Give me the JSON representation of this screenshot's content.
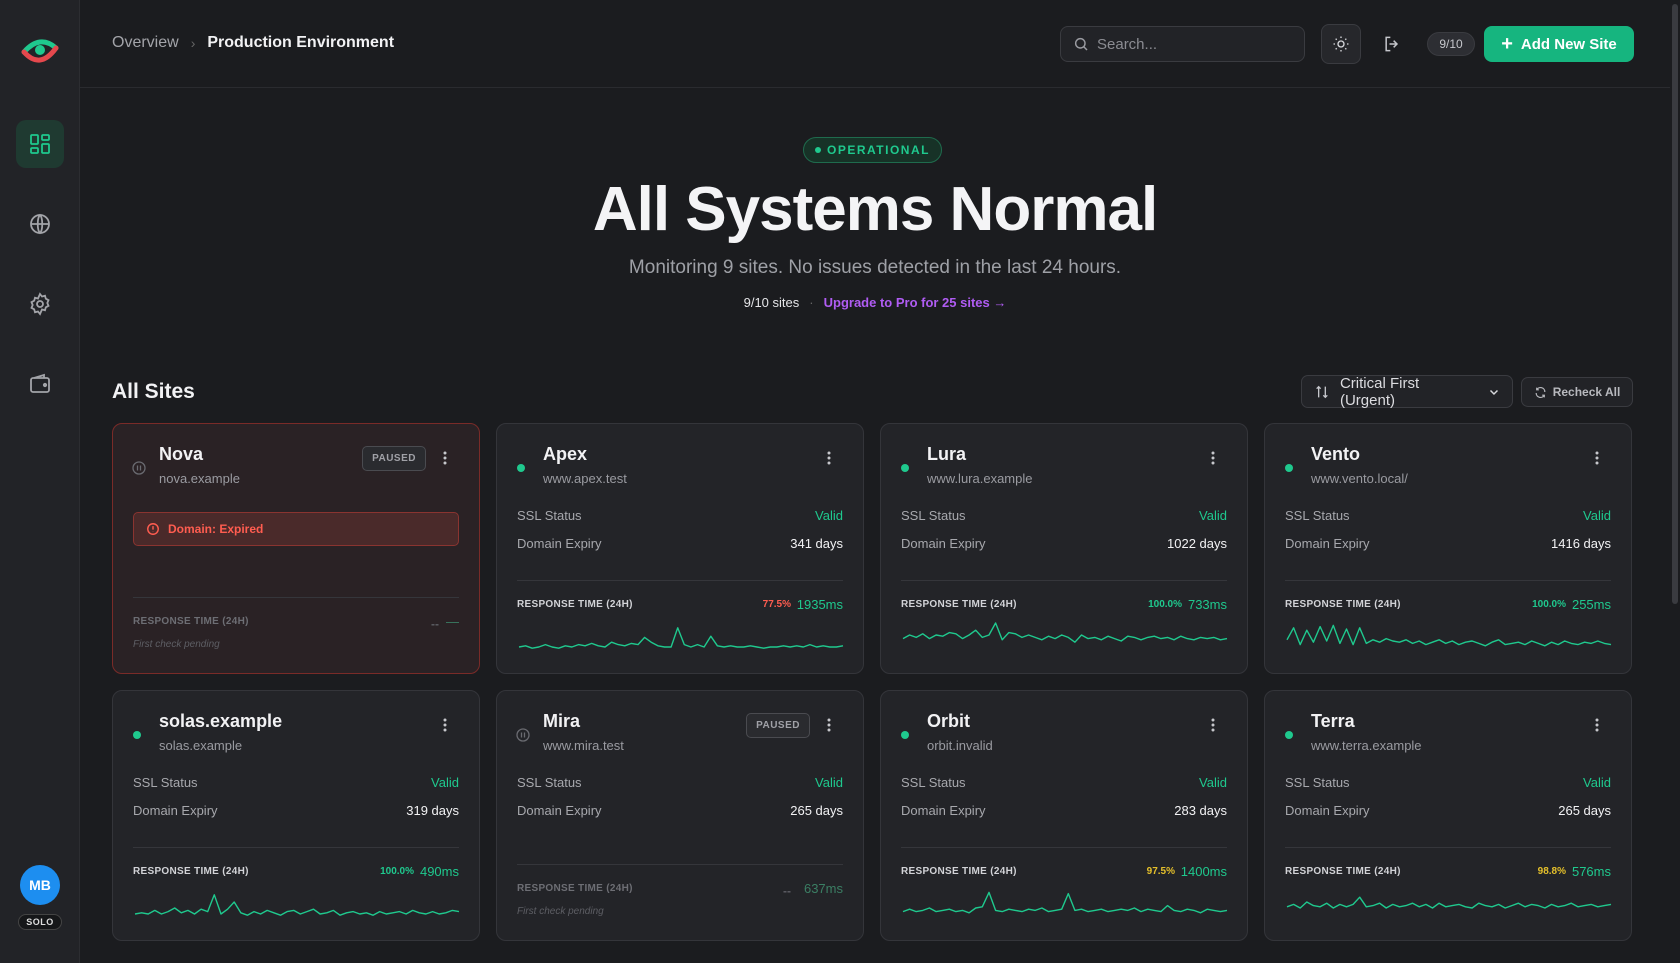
{
  "nav": {
    "items": [
      {
        "name": "dashboard",
        "icon": "dashboard-grid-icon",
        "active": true
      },
      {
        "name": "sites",
        "icon": "globe-icon",
        "active": false
      },
      {
        "name": "settings",
        "icon": "gear-icon",
        "active": false
      },
      {
        "name": "billing",
        "icon": "wallet-icon",
        "active": false
      }
    ],
    "avatar_initials": "MB",
    "plan": "SOLO"
  },
  "header": {
    "breadcrumb_root": "Overview",
    "breadcrumb_current": "Production Environment",
    "search_placeholder": "Search...",
    "quota": "9/10",
    "add_site_label": "Add New Site"
  },
  "hero": {
    "status": "OPERATIONAL",
    "title": "All Systems Normal",
    "subtitle": "Monitoring 9 sites. No issues detected in the last 24 hours.",
    "site_count": "9/10 sites",
    "separator": "·",
    "upgrade_link": "Upgrade to Pro for 25 sites →"
  },
  "sites_section": {
    "title": "All Sites",
    "sort_label": "Critical First (Urgent)",
    "recheck_label": "Recheck All"
  },
  "labels": {
    "ssl": "SSL Status",
    "expiry": "Domain Expiry",
    "response": "RESPONSE TIME (24H)",
    "pending": "First check pending",
    "paused": "PAUSED",
    "placeholder_dash": "--"
  },
  "colors": {
    "accent": "#16b57f",
    "success": "#1fc98e",
    "warning": "#e5c02b",
    "danger": "#ff5d50",
    "upgrade": "#b05cf3"
  },
  "sites": [
    {
      "name": "Nova",
      "url": "nova.example",
      "paused": true,
      "alert": "Domain: Expired",
      "rt_uptime": "--",
      "rt_ms": "—",
      "pending": true
    },
    {
      "name": "Apex",
      "url": "www.apex.test",
      "paused": false,
      "ssl": "Valid",
      "expiry": "341 days",
      "rt_uptime": "77.5%",
      "uptime_level": "danger",
      "rt_ms": "1935ms",
      "response_series": [
        20,
        19,
        21,
        20,
        18,
        20,
        21,
        19,
        20,
        18,
        19,
        17,
        19,
        20,
        16,
        18,
        19,
        17,
        18,
        12,
        16,
        19,
        20,
        20,
        4,
        18,
        20,
        18,
        20,
        11,
        19,
        20,
        19,
        20,
        20,
        19,
        20,
        21,
        20,
        20,
        19,
        20,
        19,
        20,
        18,
        20,
        19,
        20,
        20,
        19
      ]
    },
    {
      "name": "Lura",
      "url": "www.lura.example",
      "paused": false,
      "ssl": "Valid",
      "expiry": "1022 days",
      "rt_uptime": "100.0%",
      "uptime_level": "success",
      "rt_ms": "733ms",
      "response_series": [
        13,
        10,
        12,
        9,
        13,
        10,
        11,
        8,
        9,
        13,
        10,
        6,
        12,
        10,
        0,
        14,
        8,
        9,
        12,
        10,
        12,
        14,
        11,
        13,
        10,
        12,
        16,
        10,
        13,
        12,
        14,
        11,
        13,
        15,
        11,
        12,
        14,
        12,
        11,
        13,
        12,
        14,
        11,
        13,
        14,
        12,
        13,
        12,
        14,
        13
      ]
    },
    {
      "name": "Vento",
      "url": "www.vento.local/",
      "paused": false,
      "ssl": "Valid",
      "expiry": "1416 days",
      "rt_uptime": "100.0%",
      "uptime_level": "success",
      "rt_ms": "255ms",
      "response_series": [
        14,
        4,
        18,
        6,
        16,
        3,
        15,
        2,
        17,
        5,
        18,
        4,
        17,
        14,
        16,
        13,
        15,
        16,
        14,
        17,
        15,
        18,
        16,
        14,
        17,
        15,
        18,
        16,
        15,
        17,
        19,
        16,
        14,
        18,
        17,
        16,
        18,
        15,
        17,
        19,
        16,
        18,
        15,
        17,
        18,
        16,
        17,
        15,
        17,
        18
      ]
    },
    {
      "name": "solas.example",
      "url": "solas.example",
      "paused": false,
      "ssl": "Valid",
      "expiry": "319 days",
      "rt_uptime": "100.0%",
      "uptime_level": "success",
      "rt_ms": "490ms",
      "response_series": [
        20,
        19,
        20,
        17,
        20,
        18,
        15,
        19,
        17,
        20,
        16,
        18,
        4,
        20,
        16,
        10,
        19,
        21,
        18,
        20,
        17,
        19,
        21,
        18,
        17,
        20,
        18,
        16,
        20,
        19,
        17,
        21,
        19,
        18,
        20,
        19,
        21,
        18,
        20,
        19,
        18,
        20,
        17,
        19,
        20,
        18,
        20,
        19,
        17,
        18
      ]
    },
    {
      "name": "Mira",
      "url": "www.mira.test",
      "paused": true,
      "ssl": "Valid",
      "expiry": "265 days",
      "rt_uptime": "--",
      "rt_ms": "637ms",
      "pending": true
    },
    {
      "name": "Orbit",
      "url": "orbit.invalid",
      "paused": false,
      "ssl": "Valid",
      "expiry": "283 days",
      "rt_uptime": "97.5%",
      "uptime_level": "warning",
      "rt_ms": "1400ms",
      "response_series": [
        18,
        16,
        18,
        17,
        15,
        18,
        17,
        16,
        18,
        17,
        19,
        15,
        14,
        2,
        17,
        18,
        16,
        17,
        18,
        16,
        17,
        15,
        18,
        17,
        16,
        3,
        17,
        16,
        18,
        17,
        16,
        18,
        17,
        16,
        17,
        15,
        18,
        16,
        17,
        18,
        13,
        17,
        18,
        16,
        17,
        19,
        16,
        17,
        18,
        17
      ]
    },
    {
      "name": "Terra",
      "url": "www.terra.example",
      "paused": false,
      "ssl": "Valid",
      "expiry": "265 days",
      "rt_uptime": "98.8%",
      "uptime_level": "warning",
      "rt_ms": "576ms",
      "response_series": [
        14,
        12,
        15,
        10,
        13,
        14,
        11,
        15,
        12,
        14,
        12,
        6,
        14,
        13,
        11,
        15,
        12,
        14,
        13,
        11,
        14,
        12,
        15,
        11,
        14,
        13,
        12,
        14,
        15,
        11,
        13,
        14,
        12,
        15,
        13,
        11,
        14,
        12,
        13,
        15,
        12,
        14,
        13,
        11,
        14,
        13,
        12,
        14,
        13,
        12
      ]
    }
  ]
}
